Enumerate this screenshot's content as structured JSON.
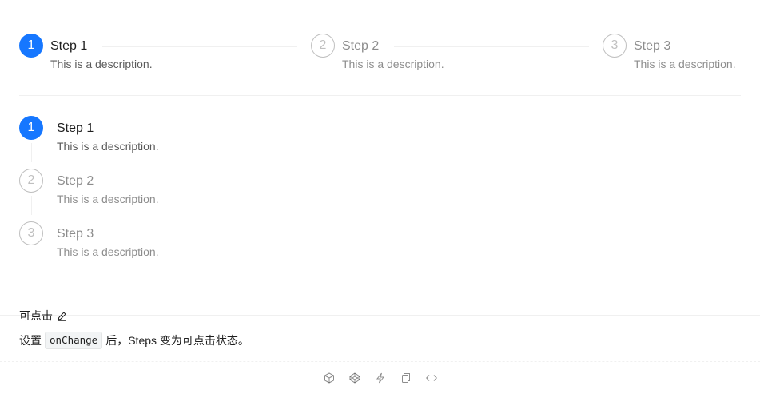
{
  "horizontal_steps": [
    {
      "number": "1",
      "title": "Step 1",
      "description": "This is a description.",
      "status": "process"
    },
    {
      "number": "2",
      "title": "Step 2",
      "description": "This is a description.",
      "status": "wait"
    },
    {
      "number": "3",
      "title": "Step 3",
      "description": "This is a description.",
      "status": "wait"
    }
  ],
  "vertical_steps": [
    {
      "number": "1",
      "title": "Step 1",
      "description": "This is a description.",
      "status": "process"
    },
    {
      "number": "2",
      "title": "Step 2",
      "description": "This is a description.",
      "status": "wait"
    },
    {
      "number": "3",
      "title": "Step 3",
      "description": "This is a description.",
      "status": "wait"
    }
  ],
  "demo_meta": {
    "title": "可点击",
    "desc_before": "设置",
    "code": "onChange",
    "desc_after": "后，Steps 变为可点击状态。"
  },
  "icons": {
    "edit": "edit-icon",
    "actions": [
      "codesandbox-icon",
      "codepen-icon",
      "stackblitz-icon",
      "copy-icon",
      "code-expand-icon"
    ]
  },
  "colors": {
    "primary": "#1677ff",
    "wait": "rgba(0,0,0,0.25)"
  }
}
